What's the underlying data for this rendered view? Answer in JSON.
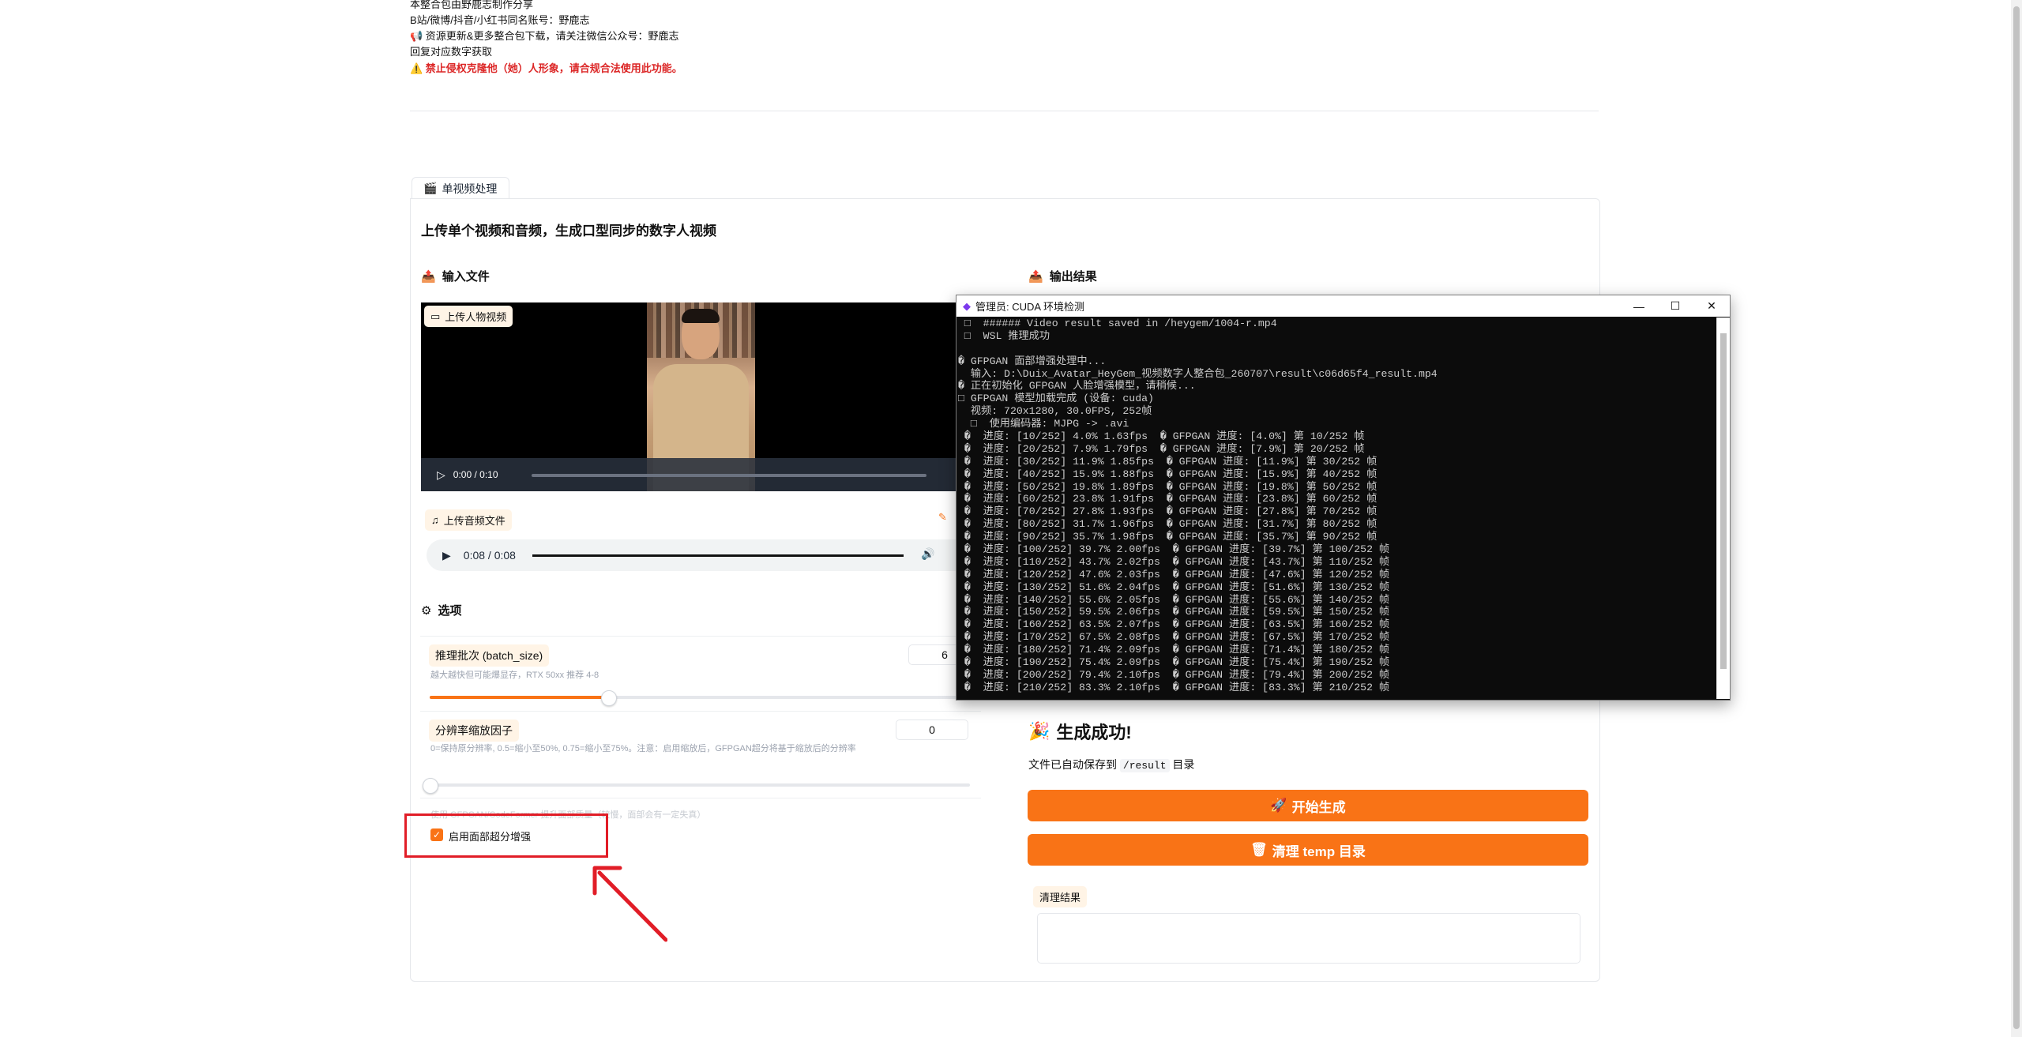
{
  "notes": [
    {
      "text": "本整合包由野鹿志制作分享",
      "red": false
    },
    {
      "text": "B站/微博/抖音/小红书同名账号：野鹿志",
      "red": false
    },
    {
      "text": "📢 资源更新&更多整合包下载，请关注微信公众号：野鹿志",
      "red": false
    },
    {
      "text": "回复对应数字获取",
      "red": false
    },
    {
      "text": "⚠️ 禁止侵权克隆他（她）人形象，请合规合法使用此功能。",
      "red": true
    }
  ],
  "tab": {
    "label": "单视频处理",
    "icon": "🎬"
  },
  "heading": "上传单个视频和音频，生成口型同步的数字人视频",
  "input_section": {
    "label": "输入文件",
    "icon": "📤"
  },
  "output_section": {
    "label": "输出结果",
    "icon": "📤"
  },
  "video_upload": {
    "label": "上传人物视频",
    "time": "0:00 / 0:10"
  },
  "audio_upload": {
    "label": "上传音频文件",
    "time": "0:08 / 0:08"
  },
  "options": {
    "label": "选项",
    "batch": {
      "label": "推理批次 (batch_size)",
      "hint": "越大越快但可能爆显存，RTX 50xx 推荐 4-8",
      "value": "6",
      "fraction": 0.33
    },
    "scale": {
      "label": "分辨率缩放因子",
      "hint": "0=保持原分辨率, 0.5=缩小至50%, 0.75=缩小至75%。注意：启用缩放后，GFPGAN超分将基于缩放后的分辨率",
      "value": "0",
      "fraction": 0.0
    },
    "gfpgan_hint": "使用 GFPGAN/CodeFormer 提升面部质量（较慢，面部会有一定失真）",
    "face_enhance": {
      "label": "启用面部超分增强",
      "checked": true
    }
  },
  "result": {
    "success": "生成成功!",
    "saved_prefix": "文件已自动保存到",
    "saved_dir": "/result",
    "saved_suffix": "目录",
    "start_button": "开始生成",
    "clean_button": "清理 temp 目录",
    "clean_label": "清理结果"
  },
  "terminal": {
    "title": "管理员:  CUDA 环境检测",
    "lines": [
      " □  ###### Video result saved in /heygem/1004-r.mp4",
      " □  WSL 推理成功",
      "",
      "� GFPGAN 面部增强处理中...",
      "  输入: D:\\Duix_Avatar_HeyGem_视频数字人整合包_260707\\result\\c06d65f4_result.mp4",
      "� 正在初始化 GFPGAN 人脸增强模型，请稍候...",
      "□ GFPGAN 模型加载完成 (设备: cuda)",
      "  视频: 720x1280, 30.0FPS, 252帧",
      "  □  使用编码器: MJPG -> .avi",
      " �  进度: [10/252] 4.0% 1.63fps  � GFPGAN 进度: [4.0%] 第 10/252 帧",
      " �  进度: [20/252] 7.9% 1.79fps  � GFPGAN 进度: [7.9%] 第 20/252 帧",
      " �  进度: [30/252] 11.9% 1.85fps  � GFPGAN 进度: [11.9%] 第 30/252 帧",
      " �  进度: [40/252] 15.9% 1.88fps  � GFPGAN 进度: [15.9%] 第 40/252 帧",
      " �  进度: [50/252] 19.8% 1.89fps  � GFPGAN 进度: [19.8%] 第 50/252 帧",
      " �  进度: [60/252] 23.8% 1.91fps  � GFPGAN 进度: [23.8%] 第 60/252 帧",
      " �  进度: [70/252] 27.8% 1.93fps  � GFPGAN 进度: [27.8%] 第 70/252 帧",
      " �  进度: [80/252] 31.7% 1.96fps  � GFPGAN 进度: [31.7%] 第 80/252 帧",
      " �  进度: [90/252] 35.7% 1.98fps  � GFPGAN 进度: [35.7%] 第 90/252 帧",
      " �  进度: [100/252] 39.7% 2.00fps  � GFPGAN 进度: [39.7%] 第 100/252 帧",
      " �  进度: [110/252] 43.7% 2.02fps  � GFPGAN 进度: [43.7%] 第 110/252 帧",
      " �  进度: [120/252] 47.6% 2.03fps  � GFPGAN 进度: [47.6%] 第 120/252 帧",
      " �  进度: [130/252] 51.6% 2.04fps  � GFPGAN 进度: [51.6%] 第 130/252 帧",
      " �  进度: [140/252] 55.6% 2.05fps  � GFPGAN 进度: [55.6%] 第 140/252 帧",
      " �  进度: [150/252] 59.5% 2.06fps  � GFPGAN 进度: [59.5%] 第 150/252 帧",
      " �  进度: [160/252] 63.5% 2.07fps  � GFPGAN 进度: [63.5%] 第 160/252 帧",
      " �  进度: [170/252] 67.5% 2.08fps  � GFPGAN 进度: [67.5%] 第 170/252 帧",
      " �  进度: [180/252] 71.4% 2.09fps  � GFPGAN 进度: [71.4%] 第 180/252 帧",
      " �  进度: [190/252] 75.4% 2.09fps  � GFPGAN 进度: [75.4%] 第 190/252 帧",
      " �  进度: [200/252] 79.4% 2.10fps  � GFPGAN 进度: [79.4%] 第 200/252 帧",
      " �  进度: [210/252] 83.3% 2.10fps  � GFPGAN 进度: [83.3%] 第 210/252 帧"
    ]
  },
  "colors": {
    "accent": "#f97316",
    "highlight": "#e11d27",
    "terminal_bg": "#0c0c0c"
  }
}
